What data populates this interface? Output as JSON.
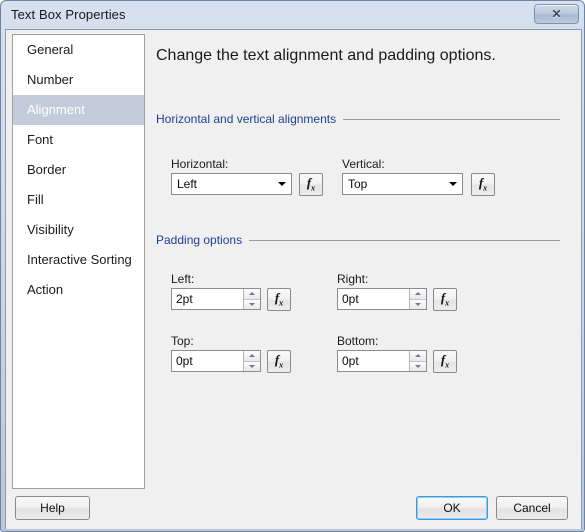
{
  "window": {
    "title": "Text Box Properties",
    "close_label": "✕"
  },
  "sidebar": {
    "items": [
      {
        "label": "General",
        "selected": false
      },
      {
        "label": "Number",
        "selected": false
      },
      {
        "label": "Alignment",
        "selected": true
      },
      {
        "label": "Font",
        "selected": false
      },
      {
        "label": "Border",
        "selected": false
      },
      {
        "label": "Fill",
        "selected": false
      },
      {
        "label": "Visibility",
        "selected": false
      },
      {
        "label": "Interactive Sorting",
        "selected": false
      },
      {
        "label": "Action",
        "selected": false
      }
    ]
  },
  "content": {
    "title": "Change the text alignment and padding options.",
    "sections": [
      {
        "label": "Horizontal and vertical alignments"
      },
      {
        "label": "Padding options"
      }
    ],
    "alignment": {
      "horizontal": {
        "label": "Horizontal:",
        "value": "Left"
      },
      "vertical": {
        "label": "Vertical:",
        "value": "Top"
      }
    },
    "padding": {
      "left": {
        "label": "Left:",
        "value": "2pt"
      },
      "right": {
        "label": "Right:",
        "value": "0pt"
      },
      "top": {
        "label": "Top:",
        "value": "0pt"
      },
      "bottom": {
        "label": "Bottom:",
        "value": "0pt"
      }
    },
    "expression_button_label": "fx"
  },
  "footer": {
    "help_label": "Help",
    "ok_label": "OK",
    "cancel_label": "Cancel"
  },
  "colors": {
    "section_heading": "#1f3f94",
    "selection": "#c2ccda",
    "dialog_bg": "#f0f0f0",
    "focus_ring": "#3c9add"
  }
}
